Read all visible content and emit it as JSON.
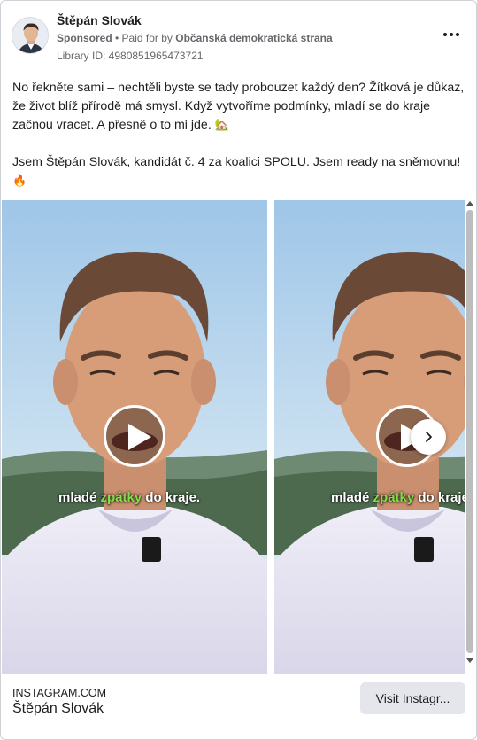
{
  "ad": {
    "page_name": "Štěpán Slovák",
    "sponsored_label": "Sponsored",
    "separator": " • ",
    "paid_for_by_label": "Paid for by ",
    "funder": "Občanská demokratická strana",
    "library_id": "Library ID: 4980851965473721",
    "more_icon": "more-horizontal-icon"
  },
  "body": {
    "paragraph_1": "No řekněte sami – nechtěli byste se tady probouzet každý den? Žítková je důkaz, že život blíž přírodě má smysl. Když vytvoříme podmínky, mladí se do kraje začnou vracet. A přesně o to mi jde.",
    "paragraph_1_emoji": "🏡",
    "paragraph_2": "Jsem Štěpán Slovák, kandidát č. 4 za koalici SPOLU. Jsem ready na sněmovnu!",
    "paragraph_2_emoji": "🔥"
  },
  "carousel": {
    "slides": [
      {
        "caption_before": "mladé ",
        "caption_highlight": "zpátky",
        "caption_after": " do kraje."
      },
      {
        "caption_before": "mladé ",
        "caption_highlight": "zpátky",
        "caption_after": " do kraje."
      }
    ],
    "highlight_color": "#7fe04a"
  },
  "footer": {
    "domain": "INSTAGRAM.COM",
    "title": "Štěpán Slovák",
    "cta_label": "Visit Instagr..."
  }
}
